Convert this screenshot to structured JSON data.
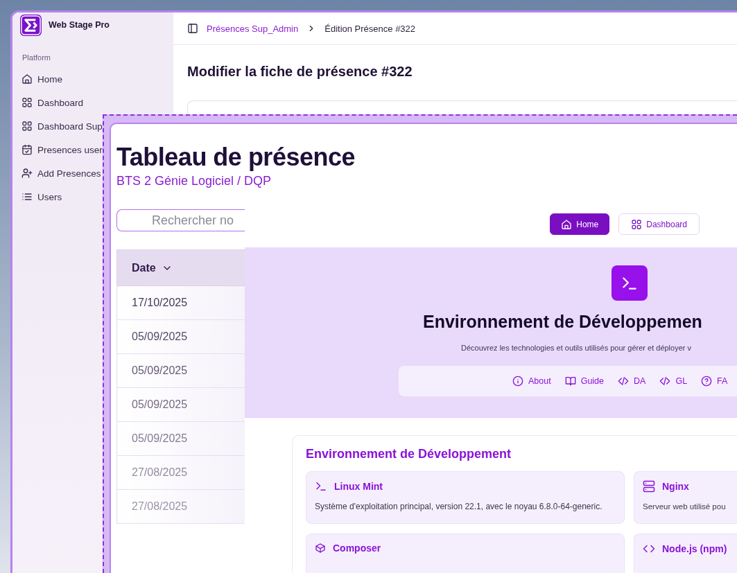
{
  "main_window": {
    "app_name": "Web Stage Pro",
    "sidebar": {
      "section": "Platform",
      "items": [
        {
          "label": "Home"
        },
        {
          "label": "Dashboard"
        },
        {
          "label": "Dashboard Sup"
        },
        {
          "label": "Presences user"
        },
        {
          "label": "Add Presences"
        },
        {
          "label": "Users"
        }
      ]
    },
    "breadcrumb": [
      "Présences Sup_Admin",
      "Édition Présence #322"
    ],
    "page_title": "Modifier la fiche de présence #322"
  },
  "attendance_window": {
    "title": "Tableau de présence",
    "subtitle": "BTS 2 Génie Logiciel / DQP",
    "search": {
      "placeholder": "Rechercher no"
    },
    "table": {
      "columns": [
        "Date"
      ],
      "rows": [
        [
          "17/10/2025"
        ],
        [
          "05/09/2025"
        ],
        [
          "05/09/2025"
        ],
        [
          "05/09/2025"
        ],
        [
          "05/09/2025"
        ],
        [
          "27/08/2025"
        ],
        [
          "27/08/2025"
        ]
      ]
    }
  },
  "environment_window": {
    "nav_buttons": [
      {
        "label": "Home",
        "selected": true
      },
      {
        "label": "Dashboard",
        "selected": false
      }
    ],
    "hero": {
      "title": "Environnement de Développemen",
      "description": "Découvrez les technologies et outils utilisés pour gérer et déployer v"
    },
    "tabs": [
      {
        "label": "About"
      },
      {
        "label": "Guide"
      },
      {
        "label": "DA"
      },
      {
        "label": "GL"
      },
      {
        "label": "FA"
      }
    ],
    "section": {
      "title": "Environnement de Développement",
      "cards": [
        {
          "title": "Linux Mint",
          "description": "Système d'exploitation principal, version 22.1, avec le noyau 6.8.0-64-generic."
        },
        {
          "title": "Nginx",
          "description": "Serveur web utilisé pou"
        },
        {
          "title": "Composer"
        },
        {
          "title": "Node.js (npm)"
        }
      ]
    }
  }
}
